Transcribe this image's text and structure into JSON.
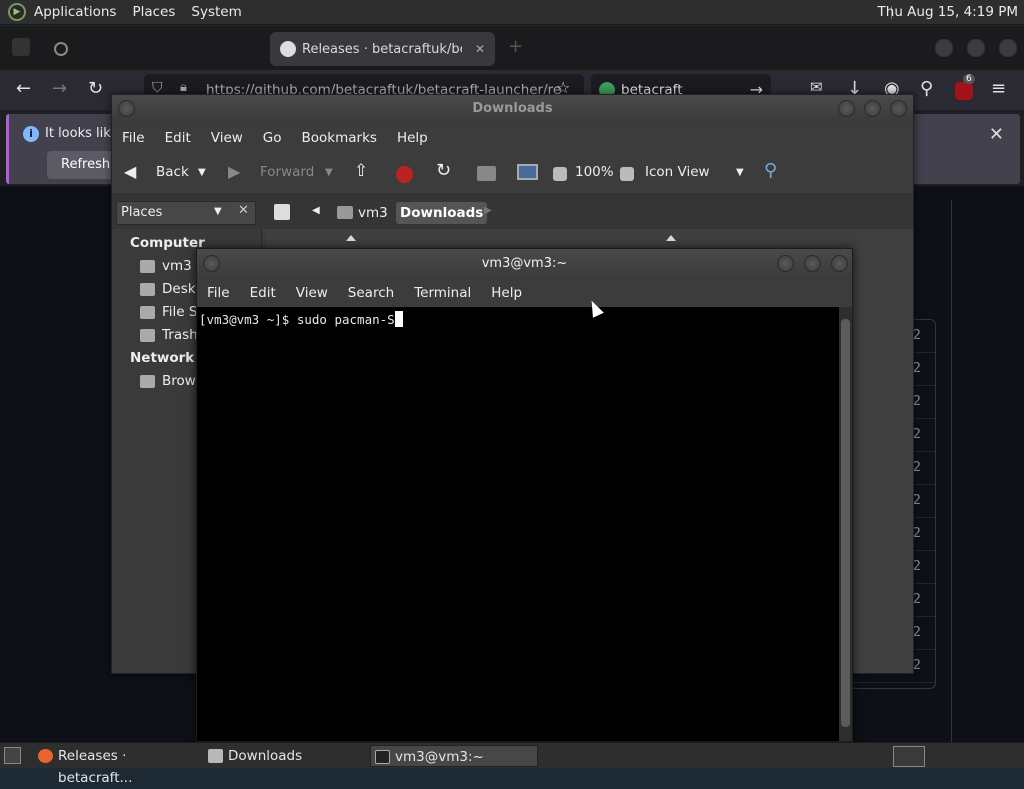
{
  "top_panel": {
    "menus": [
      "Applications",
      "Places",
      "System"
    ],
    "clock": "Thu Aug 15,  4:19 PM"
  },
  "firefox": {
    "tabs": [
      "Releases · betacraftuk/beta"
    ],
    "url": "https://github.com/betacraftuk/betacraft-launcher/re",
    "search": "betacraft",
    "info_text": "It looks like",
    "refresh_label": "Refresh",
    "notification_count": "6",
    "gh_rows": [
      "2",
      "2",
      "2",
      "2",
      "2",
      "2",
      "2",
      "2",
      "2",
      "2",
      "2"
    ]
  },
  "caja": {
    "title": "Downloads",
    "menu": [
      "File",
      "Edit",
      "View",
      "Go",
      "Bookmarks",
      "Help"
    ],
    "toolbar": {
      "back": "Back",
      "forward": "Forward",
      "zoom": "100%",
      "view_mode": "Icon View"
    },
    "places_select": "Places",
    "breadcrumbs": [
      "vm3",
      "Downloads"
    ],
    "sidebar": {
      "computer_heading": "Computer",
      "computer_items": [
        "vm3",
        "Deskt",
        "File S",
        "Trash"
      ],
      "network_heading": "Network",
      "network_items": [
        "Brow"
      ]
    }
  },
  "terminal": {
    "title": "vm3@vm3:~",
    "menu": [
      "File",
      "Edit",
      "View",
      "Search",
      "Terminal",
      "Help"
    ],
    "prompt": "[vm3@vm3 ~]$ ",
    "command": "sudo pacman-S"
  },
  "taskbar": {
    "items": [
      "Releases · betacraft...",
      "Downloads",
      "vm3@vm3:~"
    ]
  }
}
